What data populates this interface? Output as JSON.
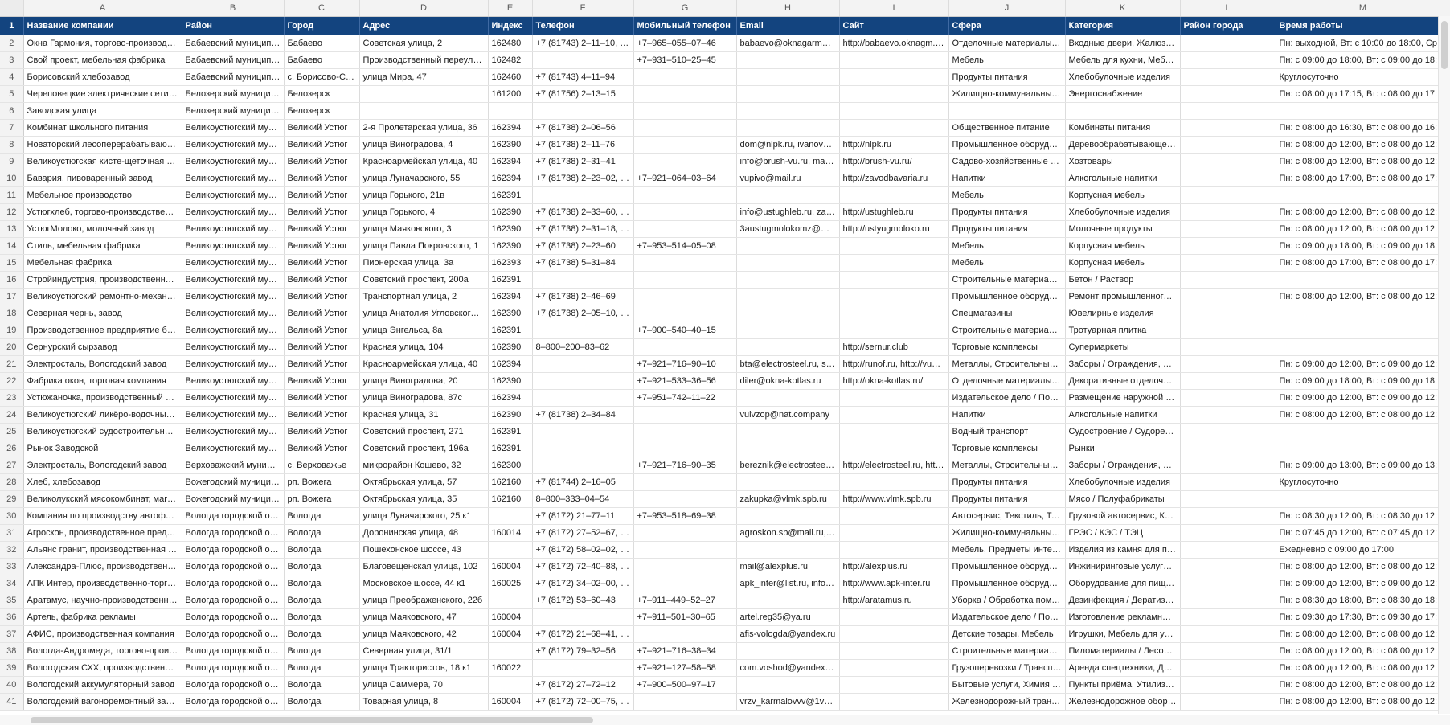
{
  "column_letters": [
    "",
    "A",
    "B",
    "C",
    "D",
    "E",
    "F",
    "G",
    "H",
    "I",
    "J",
    "K",
    "L",
    "M"
  ],
  "headers": [
    "1",
    "Название компании",
    "Район",
    "Город",
    "Адрес",
    "Индекс",
    "Телефон",
    "Мобильный телефон",
    "Email",
    "Сайт",
    "Сфера",
    "Категория",
    "Район города",
    "Время работы"
  ],
  "rows": [
    [
      "2",
      "Окна Гармония, торгово-производст…",
      "Бабаевский муниципа…",
      "Бабаево",
      "Советская улица, 2",
      "162480",
      "+7 (81743) 2–11–10, 8–…",
      "+7–965–055–07–46",
      "babaevo@oknagarmoni…",
      "http://babaevo.oknagm.ru…",
      "Отделочные материалы, П…",
      "Входные двери, Жалюзи, …",
      "",
      "Пн: выходной, Вт: с 10:00 до 18:00, Ср: с…"
    ],
    [
      "3",
      "Свой проект, мебельная фабрика",
      "Бабаевский муниципа…",
      "Бабаево",
      "Производственный переулок, …",
      "162482",
      "",
      "+7–931–510–25–45",
      "",
      "",
      "Мебель",
      "Мебель для кухни, Мебель…",
      "",
      "Пн: с 09:00 до 18:00, Вт: с 09:00 до 18:00, С…"
    ],
    [
      "4",
      "Борисовский хлебозавод",
      "Бабаевский муниципа…",
      "с. Борисово-Су…",
      "улица Мира, 47",
      "162460",
      "+7 (81743) 4–11–94",
      "",
      "",
      "",
      "Продукты питания",
      "Хлебобулочные изделия",
      "",
      "Круглосуточно"
    ],
    [
      "5",
      "Череповецкие электрические сети, п…",
      "Белозерский муницип…",
      "Белозерск",
      "",
      "161200",
      "+7 (81756) 2–13–15",
      "",
      "",
      "",
      "Жилищно-коммунальные …",
      "Энергоснабжение",
      "",
      "Пн: с 08:00 до 17:15, Вт: с 08:00 до 17:15, С…"
    ],
    [
      "6",
      "Заводская улица",
      "Белозерский муницип…",
      "Белозерск",
      "",
      "",
      "",
      "",
      "",
      "",
      "",
      "",
      "",
      ""
    ],
    [
      "7",
      "Комбинат школьного питания",
      "Великоустюгский муни…",
      "Великий Устюг",
      "2-я Пролетарская улица, 36",
      "162394",
      "+7 (81738) 2–06–56",
      "",
      "",
      "",
      "Общественное питание",
      "Комбинаты питания",
      "",
      "Пн: с 08:00 до 16:30, Вт: с 08:00 до 16:30, С…"
    ],
    [
      "8",
      "Новаторский лесоперерабатывающи…",
      "Великоустюгский муни…",
      "Великий Устюг",
      "улица Виноградова, 4",
      "162390",
      "+7 (81738) 2–11–76",
      "",
      "dom@nlpk.ru, ivanov@…",
      "http://nlpk.ru",
      "Промышленное оборудов…",
      "Деревообрабатывающее …",
      "",
      "Пн: с 08:00 до 12:00, Вт: с 08:00 до 12:00, С…"
    ],
    [
      "9",
      "Великоустюгская кисте-щеточная фа…",
      "Великоустюгский муни…",
      "Великий Устюг",
      "Красноармейская улица, 40",
      "162394",
      "+7 (81738) 2–31–41",
      "",
      "info@brush-vu.ru, mana…",
      "http://brush-vu.ru/",
      "Садово-хозяйственные то…",
      "Хозтовары",
      "",
      "Пн: с 08:00 до 12:00, Вт: с 08:00 до 12:00, С…"
    ],
    [
      "10",
      "Бавария, пивоваренный завод",
      "Великоустюгский муни…",
      "Великий Устюг",
      "улица Луначарского, 55",
      "162394",
      "+7 (81738) 2–23–02, +7…",
      "+7–921–064–03–64",
      "vupivo@mail.ru",
      "http://zavodbavaria.ru",
      "Напитки",
      "Алкогольные напитки",
      "",
      "Пн: с 08:00 до 17:00, Вт: с 08:00 до 17:00, С…"
    ],
    [
      "11",
      "Мебельное производство",
      "Великоустюгский муни…",
      "Великий Устюг",
      "улица Горького, 21в",
      "162391",
      "",
      "",
      "",
      "",
      "Мебель",
      "Корпусная мебель",
      "",
      ""
    ],
    [
      "12",
      "Устюгхлеб, торгово-производственна…",
      "Великоустюгский муни…",
      "Великий Устюг",
      "улица Горького, 4",
      "162390",
      "+7 (81738) 2–33–60, +7…",
      "",
      "info@ustughleb.ru, zaka…",
      "http://ustughleb.ru",
      "Продукты питания",
      "Хлебобулочные изделия",
      "",
      "Пн: с 08:00 до 12:00, Вт: с 08:00 до 12:00, С…"
    ],
    [
      "13",
      "УстюгМолоко, молочный завод",
      "Великоустюгский муни…",
      "Великий Устюг",
      "улица Маяковского, 3",
      "162390",
      "+7 (81738) 2–31–18, +7…",
      "",
      "3austugmolokomz@ma…",
      "http://ustyugmoloko.ru",
      "Продукты питания",
      "Молочные продукты",
      "",
      "Пн: с 08:00 до 12:00, Вт: с 08:00 до 12:00, С…"
    ],
    [
      "14",
      "Стиль, мебельная фабрика",
      "Великоустюгский муни…",
      "Великий Устюг",
      "улица Павла Покровского, 1",
      "162390",
      "+7 (81738) 2–23–60",
      "+7–953–514–05–08",
      "",
      "",
      "Мебель",
      "Корпусная мебель",
      "",
      "Пн: с 09:00 до 18:00, Вт: с 09:00 до 18:00, С…"
    ],
    [
      "15",
      "Мебельная фабрика",
      "Великоустюгский муни…",
      "Великий Устюг",
      "Пионерская улица, 3а",
      "162393",
      "+7 (81738) 5–31–84",
      "",
      "",
      "",
      "Мебель",
      "Корпусная мебель",
      "",
      "Пн: с 08:00 до 17:00, Вт: с 08:00 до 17:00, С…"
    ],
    [
      "16",
      "Стройиндустрия, производственная о…",
      "Великоустюгский муни…",
      "Великий Устюг",
      "Советский проспект, 200а",
      "162391",
      "",
      "",
      "",
      "",
      "Строительные материалы …",
      "Бетон / Раствор",
      "",
      ""
    ],
    [
      "17",
      "Великоустюгский ремонтно-механич…",
      "Великоустюгский муни…",
      "Великий Устюг",
      "Транспортная улица, 2",
      "162394",
      "+7 (81738) 2–46–69",
      "",
      "",
      "",
      "Промышленное оборудов…",
      "Ремонт промышленного о…",
      "",
      "Пн: с 08:00 до 12:00, Вт: с 08:00 до 12:00, С…"
    ],
    [
      "18",
      "Северная чернь, завод",
      "Великоустюгский муни…",
      "Великий Устюг",
      "улица Анатолия Угловского, 1",
      "162390",
      "+7 (81738) 2–05–10, +7…",
      "",
      "",
      "",
      "Спецмагазины",
      "Ювелирные изделия",
      "",
      ""
    ],
    [
      "19",
      "Производственное предприятие брус…",
      "Великоустюгский муни…",
      "Великий Устюг",
      "улица Энгельса, 8а",
      "162391",
      "",
      "+7–900–540–40–15",
      "",
      "",
      "Строительные материалы …",
      "Тротуарная плитка",
      "",
      ""
    ],
    [
      "20",
      "Сернурский сырзавод",
      "Великоустюгский муни…",
      "Великий Устюг",
      "Красная улица, 104",
      "162390",
      "8–800–200–83–62",
      "",
      "",
      "http://sernur.club",
      "Торговые комплексы",
      "Супермаркеты",
      "",
      ""
    ],
    [
      "21",
      "Электросталь, Вологодский завод",
      "Великоустюгский муни…",
      "Великий Устюг",
      "Красноармейская улица, 40",
      "162394",
      "",
      "+7–921–716–90–10",
      "bta@electrosteel.ru, sal…",
      "http://runof.ru, http://vust…",
      "Металлы, Строительные м…",
      "Заборы / Ограждения, Кр…",
      "",
      "Пн: с 09:00 до 12:00, Вт: с 09:00 до 12:00, С…"
    ],
    [
      "22",
      "Фабрика окон, торговая компания",
      "Великоустюгский муни…",
      "Великий Устюг",
      "улица Виноградова, 20",
      "162390",
      "",
      "+7–921–533–36–56",
      "diler@okna-kotlas.ru",
      "http://okna-kotlas.ru/",
      "Отделочные материалы, С…",
      "Декоративные отделочны…",
      "",
      "Пн: с 09:00 до 18:00, Вт: с 09:00 до 18:00, С…"
    ],
    [
      "23",
      "Устюжаночка, производственный цех",
      "Великоустюгский муни…",
      "Великий Устюг",
      "улица Виноградова, 87с",
      "162394",
      "",
      "+7–951–742–11–22",
      "",
      "",
      "Издательское дело / Поли…",
      "Размещение наружной ре…",
      "",
      "Пн: с 09:00 до 12:00, Вт: с 09:00 до 12:00, С…"
    ],
    [
      "24",
      "Великоустюгский ликёро-водочный з…",
      "Великоустюгский муни…",
      "Великий Устюг",
      "Красная улица, 31",
      "162390",
      "+7 (81738) 2–34–84",
      "",
      "vulvzop@nat.company",
      "",
      "Напитки",
      "Алкогольные напитки",
      "",
      "Пн: с 08:00 до 12:00, Вт: с 08:00 до 12:00, С…"
    ],
    [
      "25",
      "Великоустюгский судостроительно-су…",
      "Великоустюгский муни…",
      "Великий Устюг",
      "Советский проспект, 271",
      "162391",
      "",
      "",
      "",
      "",
      "Водный транспорт",
      "Судостроение / Судоремонт",
      "",
      ""
    ],
    [
      "26",
      "Рынок Заводской",
      "Великоустюгский муни…",
      "Великий Устюг",
      "Советский проспект, 196а",
      "162391",
      "",
      "",
      "",
      "",
      "Торговые комплексы",
      "Рынки",
      "",
      ""
    ],
    [
      "27",
      "Электросталь, Вологодский завод",
      "Верховажский муници…",
      "с. Верховажье",
      "микрорайон Кошево, 32",
      "162300",
      "",
      "+7–921–716–90–35",
      "bereznik@electrosteel.ru…",
      "http://electrosteel.ru, http:…",
      "Металлы, Строительные м…",
      "Заборы / Ограждения, Кр…",
      "",
      "Пн: с 09:00 до 13:00, Вт: с 09:00 до 13:00, С…"
    ],
    [
      "28",
      "Хлеб, хлебозавод",
      "Вожегодский муницип…",
      "рп. Вожега",
      "Октябрьская улица, 57",
      "162160",
      "+7 (81744) 2–16–05",
      "",
      "",
      "",
      "Продукты питания",
      "Хлебобулочные изделия",
      "",
      "Круглосуточно"
    ],
    [
      "29",
      "Великолукский мясокомбинат, магазин",
      "Вожегодский муницип…",
      "рп. Вожега",
      "Октябрьская улица, 35",
      "162160",
      "8–800–333–04–54",
      "",
      "zakupka@vlmk.spb.ru",
      "http://www.vlmk.spb.ru",
      "Продукты питания",
      "Мясо / Полуфабрикаты",
      "",
      ""
    ],
    [
      "30",
      "Компания по производству автофург…",
      "Вологда городской ок…",
      "Вологда",
      "улица Луначарского, 25 к1",
      "",
      "+7 (8172) 21–77–11",
      "+7–953–518–69–38",
      "",
      "",
      "Автосервис, Текстиль, Тор…",
      "Грузовой автосервис, Кар…",
      "",
      "Пн: с 08:30 до 12:00, Вт: с 08:30 до 12:00, С…"
    ],
    [
      "31",
      "Агроскон, производственное предпр…",
      "Вологда городской ок…",
      "Вологда",
      "Доронинская улица, 48",
      "160014",
      "+7 (8172) 27–52–67, +7…",
      "",
      "agroskon.sb@mail.ru, y…",
      "",
      "Жилищно-коммунальные …",
      "ГРЭС / КЭС / ТЭЦ",
      "",
      "Пн: с 07:45 до 12:00, Вт: с 07:45 до 12:00, С…"
    ],
    [
      "32",
      "Альянс гранит, производственная ко…",
      "Вологда городской ок…",
      "Вологда",
      "Пошехонское шоссе, 43",
      "",
      "+7 (8172) 58–02–02, +7…",
      "",
      "",
      "",
      "Мебель, Предметы интерь…",
      "Изделия из камня для пом…",
      "",
      "Ежедневно с 09:00 до 17:00"
    ],
    [
      "33",
      "Александра-Плюс, производственное…",
      "Вологда городской ок…",
      "Вологда",
      "Благовещенская улица, 102",
      "160004",
      "+7 (8172) 72–40–88, +7…",
      "",
      "mail@alexplus.ru",
      "http://alexplus.ru",
      "Промышленное оборудов…",
      "Инжиниринговые услуги, …",
      "",
      "Пн: с 08:00 до 12:00, Вт: с 08:00 до 12:00, С…"
    ],
    [
      "34",
      "АПК Интер, производственно-торгов…",
      "Вологда городской ок…",
      "Вологда",
      "Московское шоссе, 44 к1",
      "160025",
      "+7 (8172) 34–02–00, +7…",
      "",
      "apk_inter@list.ru, info@…",
      "http://www.apk-inter.ru",
      "Промышленное оборудов…",
      "Оборудование для пищев…",
      "",
      "Пн: с 09:00 до 12:00, Вт: с 09:00 до 12:00, С…"
    ],
    [
      "35",
      "Аратамус, научно-производственное …",
      "Вологда городской ок…",
      "Вологда",
      "улица Преображенского, 22б",
      "",
      "+7 (8172) 53–60–43",
      "+7–911–449–52–27",
      "",
      "http://aratamus.ru",
      "Уборка / Обработка поме…",
      "Дезинфекция / Дератизац…",
      "",
      "Пн: с 08:30 до 18:00, Вт: с 08:30 до 18:00, С…"
    ],
    [
      "36",
      "Артель, фабрика рекламы",
      "Вологда городской ок…",
      "Вологда",
      "улица Маяковского, 47",
      "160004",
      "",
      "+7–911–501–30–65",
      "artel.reg35@ya.ru",
      "",
      "Издательское дело / Поли…",
      "Изготовление рекламных …",
      "",
      "Пн: с 09:30 до 17:30, Вт: с 09:30 до 17:30, С…"
    ],
    [
      "37",
      "АФИС, производственная компания",
      "Вологда городской ок…",
      "Вологда",
      "улица Маяковского, 42",
      "160004",
      "+7 (8172) 21–68–41, +7…",
      "",
      "afis-vologda@yandex.ru",
      "",
      "Детские товары, Мебель",
      "Игрушки, Мебель для уче…",
      "",
      "Пн: с 08:00 до 12:00, Вт: с 08:00 до 12:00, С…"
    ],
    [
      "38",
      "Вологда-Андромеда, торгово-произв…",
      "Вологда городской ок…",
      "Вологда",
      "Северная улица, 31/1",
      "",
      "+7 (8172) 79–32–56",
      "+7–921–716–38–34",
      "",
      "",
      "Строительные материалы …",
      "Пиломатериалы / Лесомат…",
      "",
      "Пн: с 08:00 до 12:00, Вт: с 08:00 до 12:00, С…"
    ],
    [
      "39",
      "Вологодская СХХ, производственно-т…",
      "Вологда городской ок…",
      "Вологда",
      "улица Трактористов, 18 к1",
      "160022",
      "",
      "+7–921–127–58–58",
      "com.voshod@yandex.ru…",
      "",
      "Грузоперевозки / Транспо…",
      "Аренда спецтехники, Дере…",
      "",
      "Пн: с 08:00 до 12:00, Вт: с 08:00 до 12:00, С…"
    ],
    [
      "40",
      "Вологодский аккумуляторный завод",
      "Вологда городской ок…",
      "Вологда",
      "улица Саммера, 70",
      "",
      "+7 (8172) 27–72–12",
      "+7–900–500–97–17",
      "",
      "",
      "Бытовые услуги, Химия / В…",
      "Пункты приёма, Утилизац…",
      "",
      "Пн: с 08:00 до 12:00, Вт: с 08:00 до 12:00, С…"
    ],
    [
      "41",
      "Вологодский вагоноремонтный завод",
      "Вологда городской ок…",
      "Вологда",
      "Товарная улица, 8",
      "160004",
      "+7 (8172) 72–00–75, +7…",
      "",
      "vrzv_karmalovvv@1vrk.ru",
      "",
      "Железнодорожный трансп…",
      "Железнодорожное обору…",
      "",
      "Пн: с 08:00 до 12:00, Вт: с 08:00 до 12:00, С…"
    ]
  ]
}
